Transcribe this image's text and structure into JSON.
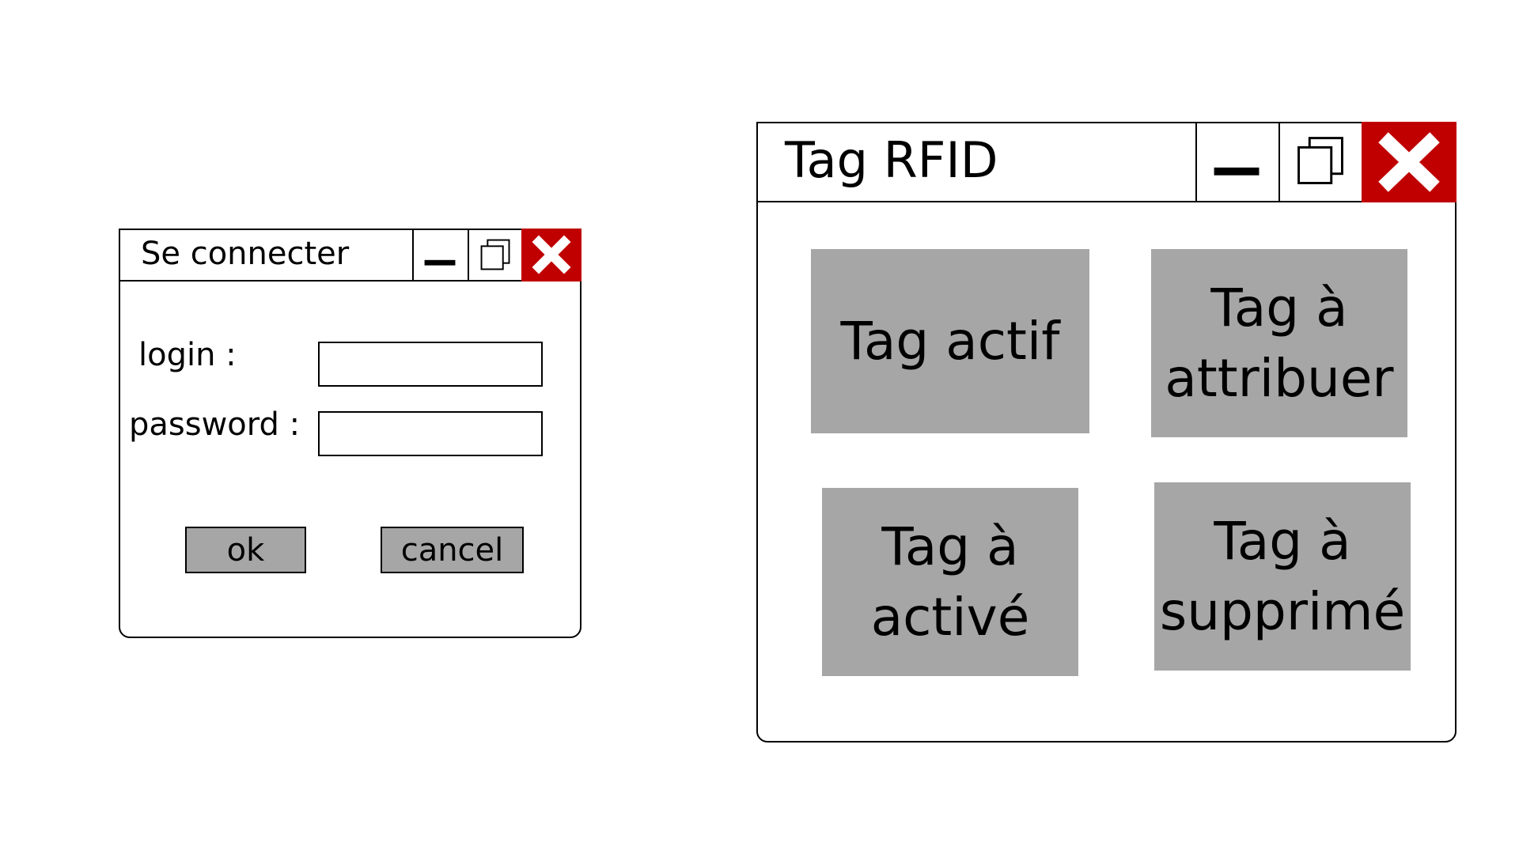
{
  "login_window": {
    "title": "Se connecter",
    "login_label": "login :",
    "login_value": "",
    "password_label": "password :",
    "password_value": "",
    "ok_label": "ok",
    "cancel_label": "cancel"
  },
  "rfid_window": {
    "title": "Tag RFID",
    "tiles": [
      {
        "label": "Tag actif"
      },
      {
        "label": "Tag à attribuer"
      },
      {
        "label": "Tag à activé"
      },
      {
        "label": "Tag à supprimé"
      }
    ]
  },
  "colors": {
    "close_button": "#c00000",
    "tile_background": "#a6a6a6",
    "border": "#000000",
    "background": "#ffffff"
  },
  "icons": {
    "minimize": "minimize-icon",
    "maximize": "restore-icon",
    "close": "close-icon"
  }
}
